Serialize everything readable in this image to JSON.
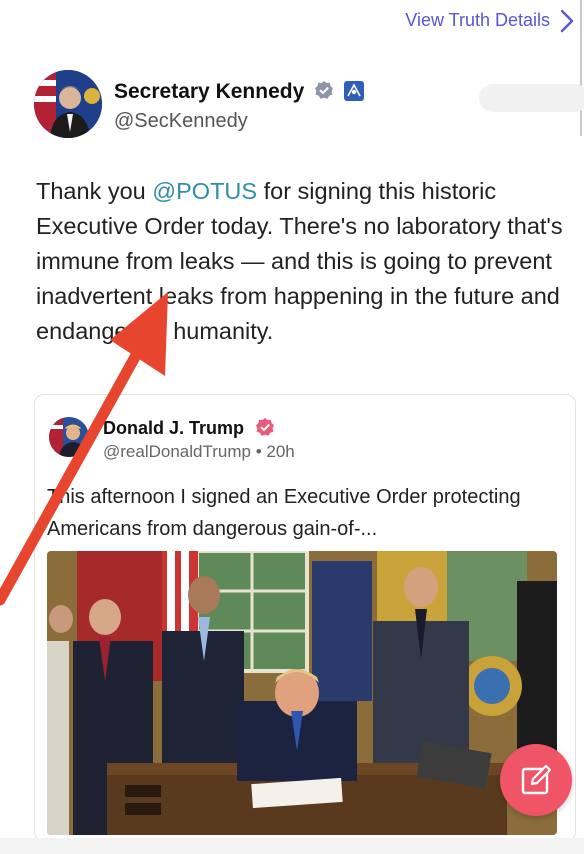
{
  "top": {
    "view_details_label": "View Truth Details"
  },
  "post": {
    "author_name": "Secretary Kennedy",
    "author_handle": "@SecKennedy",
    "text_before_mention": "Thank you ",
    "mention": "@POTUS",
    "text_after_mention": " for signing this historic Executive Order today. There's no laboratory that's immune from leaks — and this is going to prevent inadvertent leaks from happening in the future and endangering humanity."
  },
  "quote": {
    "author_name": "Donald J. Trump",
    "author_handle": "@realDonaldTrump",
    "separator": "•",
    "age": "20h",
    "text": "This afternoon I signed an Executive Order protecting Americans from dangerous gain-of-..."
  },
  "colors": {
    "link_purple": "#5a55d6",
    "mention_teal": "#2e8fa6",
    "compose_button": "#f05467",
    "annotation_arrow": "#e8452e"
  },
  "icons": {
    "chevron": "chevron-right-icon",
    "verified": "verified-badge-icon",
    "government": "government-seal-icon",
    "compose": "compose-icon",
    "annotation": "red-arrow-annotation"
  }
}
